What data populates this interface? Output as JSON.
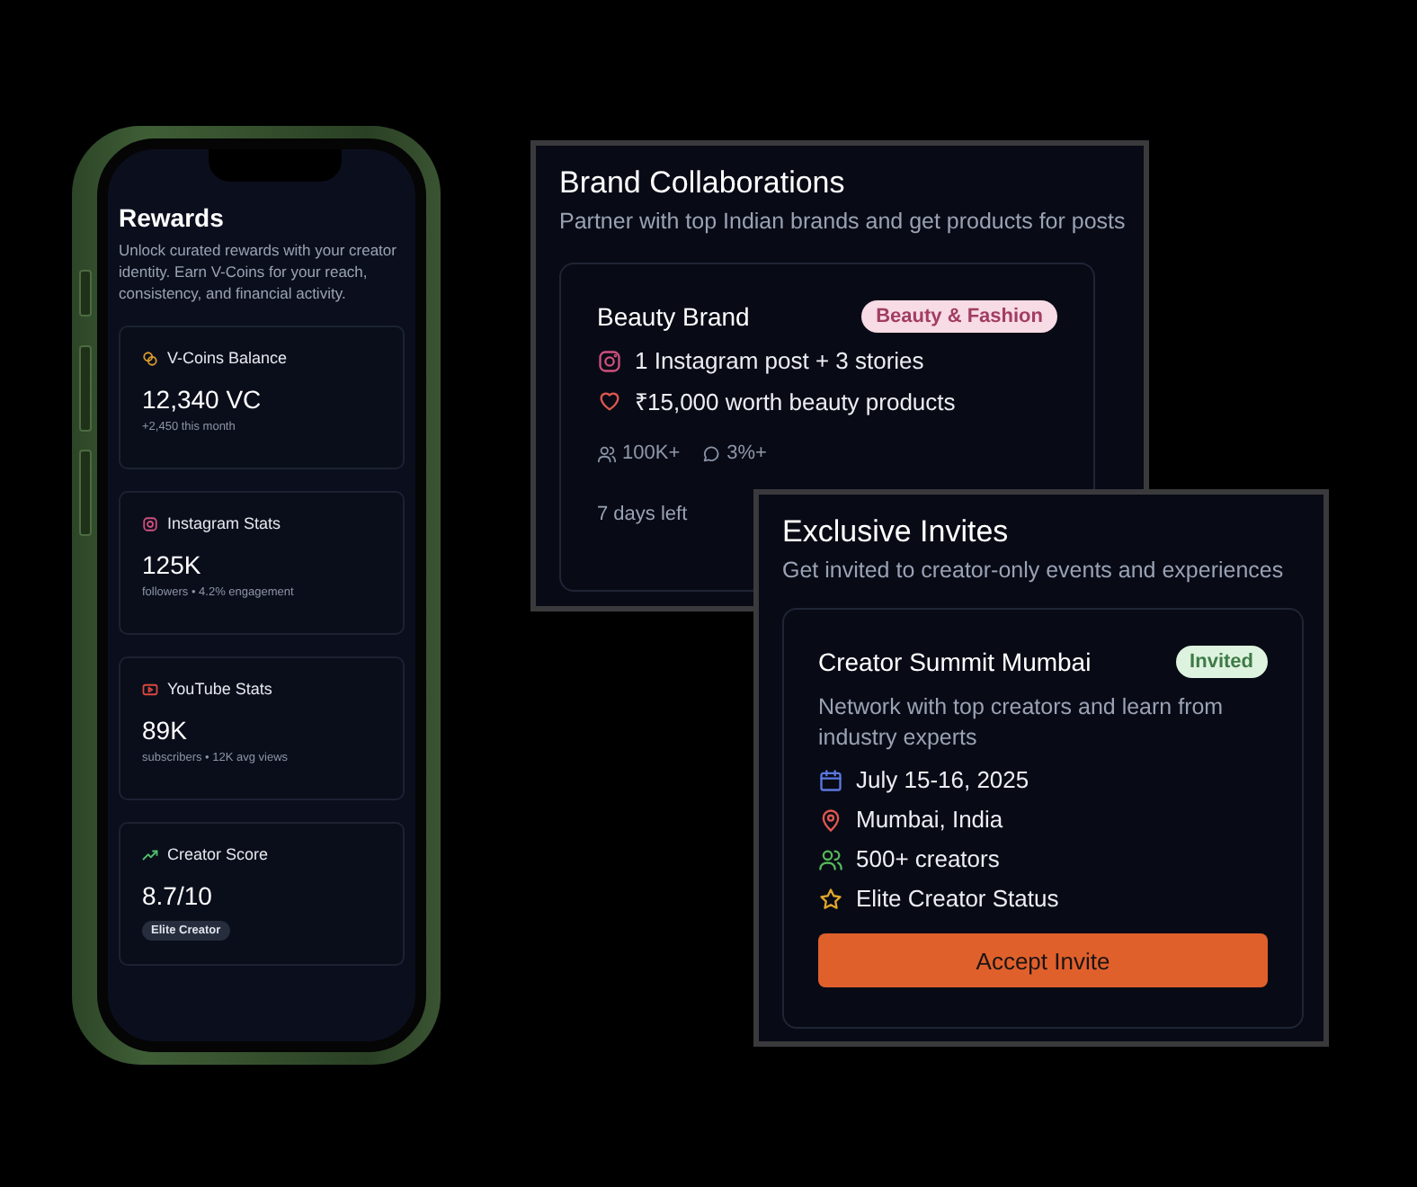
{
  "phone": {
    "title": "Rewards",
    "description": "Unlock curated rewards with your creator identity. Earn V-Coins for your reach, consistency, and financial activity.",
    "stats": [
      {
        "kind": "coins",
        "label": "V-Coins Balance",
        "value": "12,340 VC",
        "note": "+2,450 this month"
      },
      {
        "kind": "instagram",
        "label": "Instagram Stats",
        "value": "125K",
        "note": "followers • 4.2% engagement"
      },
      {
        "kind": "youtube",
        "label": "YouTube Stats",
        "value": "89K",
        "note": "subscribers • 12K avg views"
      },
      {
        "kind": "score",
        "label": "Creator Score",
        "value": "8.7/10",
        "badge": "Elite Creator"
      }
    ]
  },
  "brand_collaborations": {
    "title": "Brand Collaborations",
    "subtitle": "Partner with top Indian brands and get products for posts",
    "offer": {
      "brand": "Beauty Brand",
      "tag": "Beauty & Fashion",
      "details": [
        {
          "kind": "instagram",
          "text": "1 Instagram post + 3 stories"
        },
        {
          "kind": "heart",
          "text": "₹15,000 worth beauty products"
        }
      ],
      "metrics": [
        {
          "kind": "people",
          "text": "100K+"
        },
        {
          "kind": "comment",
          "text": "3%+"
        }
      ],
      "deadline": "7 days left"
    }
  },
  "exclusive_invites": {
    "title": "Exclusive Invites",
    "subtitle": "Get invited to creator-only events and experiences",
    "event": {
      "name": "Creator Summit Mumbai",
      "status": "Invited",
      "description": "Network with top creators and learn from industry experts",
      "details": [
        {
          "kind": "calendar",
          "text": "July 15-16, 2025"
        },
        {
          "kind": "pin",
          "text": "Mumbai, India"
        },
        {
          "kind": "people",
          "text": "500+ creators"
        },
        {
          "kind": "star",
          "text": "Elite Creator Status"
        }
      ],
      "action": "Accept Invite"
    }
  }
}
